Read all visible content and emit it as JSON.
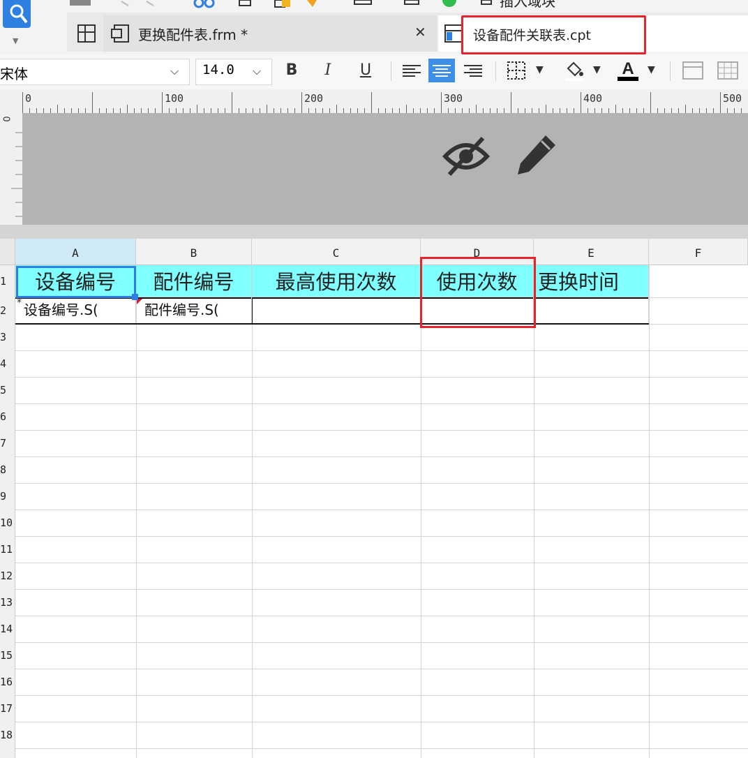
{
  "tabs": [
    {
      "label": "更换配件表.frm *",
      "close_label": "✕",
      "icon": "form-file-icon"
    },
    {
      "label": "设备配件关联表.cpt",
      "icon": "report-file-icon"
    }
  ],
  "toolbar_partial": {
    "insert_label": "插入域块"
  },
  "format_bar": {
    "font_name": "宋体",
    "font_size": "14.0",
    "bold_label": "B",
    "italic_label": "I",
    "underline_label": "U",
    "dropdown_glyph": "⌵"
  },
  "ruler": {
    "ticks": [
      "0",
      "100",
      "200",
      "300",
      "400",
      "500"
    ],
    "vertical_zero": "0"
  },
  "preview_icons": [
    "hidden-eye-icon",
    "edit-pencil-icon"
  ],
  "grid": {
    "columns": [
      "A",
      "B",
      "C",
      "D",
      "E",
      "F"
    ],
    "row_numbers": [
      "1",
      "2",
      "3",
      "4",
      "5",
      "6",
      "7",
      "8",
      "9",
      "10",
      "11",
      "12",
      "13",
      "14",
      "15",
      "16",
      "17",
      "18"
    ],
    "header_row": [
      "设备编号",
      "配件编号",
      "最高使用次数",
      "使用次数",
      "更换时间"
    ],
    "data_row": [
      "设备编号.S(",
      "配件编号.S(",
      "",
      "",
      ""
    ],
    "selected_cell": "A1"
  },
  "colors": {
    "header_fill": "#80ffff",
    "highlight": "#e8232b",
    "selection": "#2f7de2",
    "accent": "#3d8fe8"
  }
}
